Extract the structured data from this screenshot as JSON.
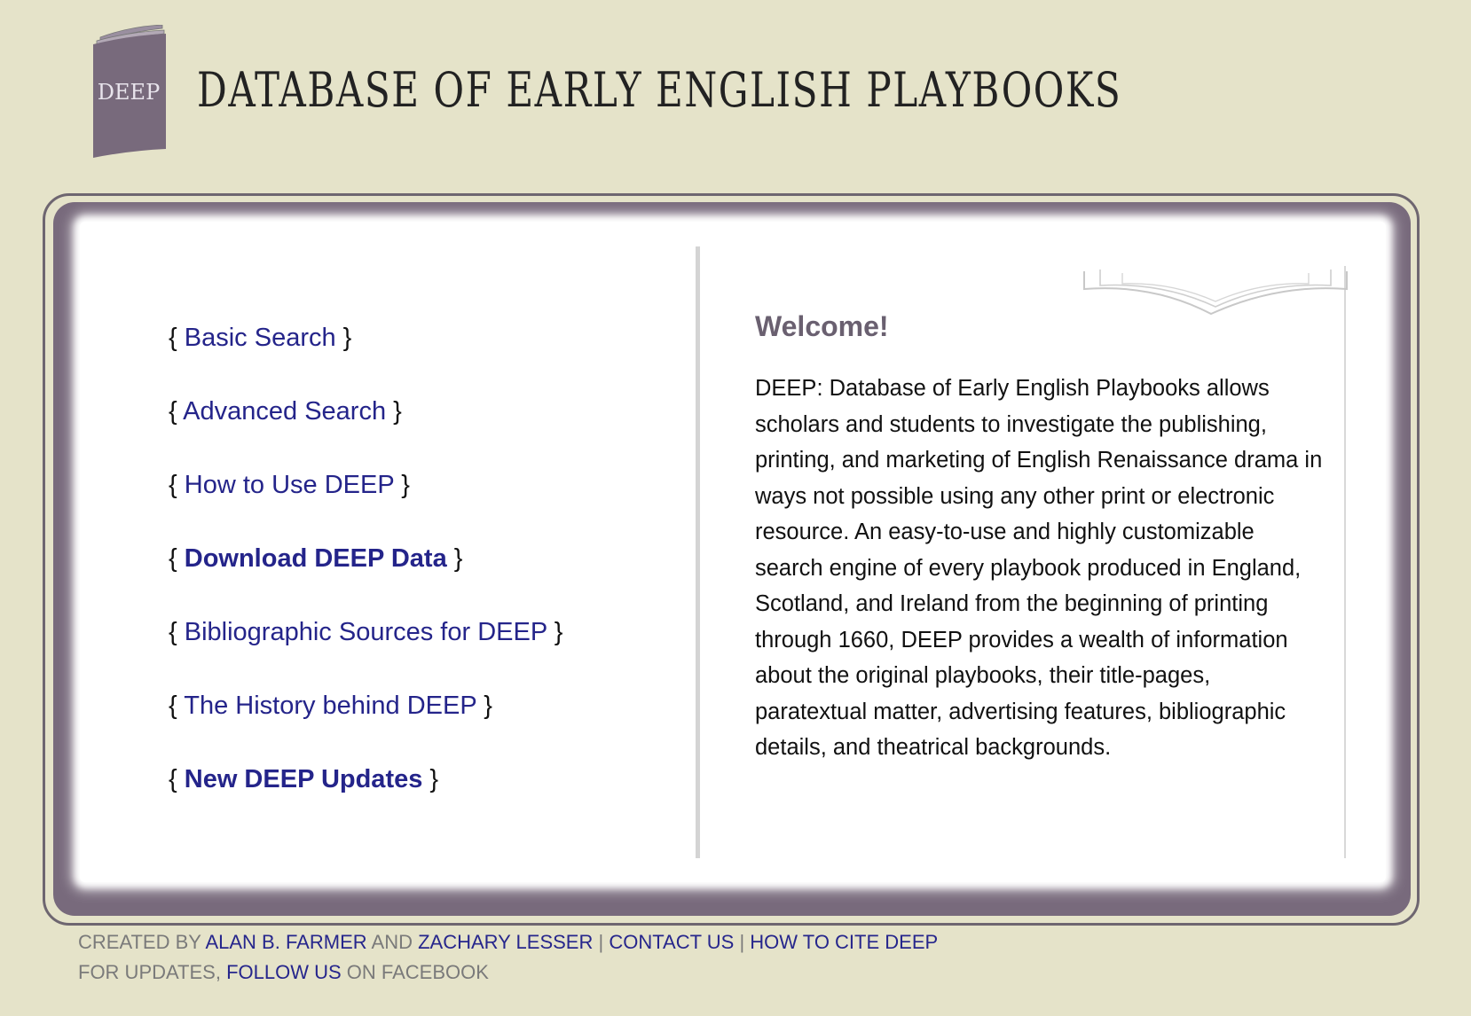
{
  "header": {
    "logo_text": "DEEP",
    "title": "DATABASE OF EARLY ENGLISH PLAYBOOKS"
  },
  "nav": {
    "items": [
      {
        "label": "Basic Search",
        "bold": false
      },
      {
        "label": "Advanced Search",
        "bold": false
      },
      {
        "label": "How to Use DEEP",
        "bold": false
      },
      {
        "label": "Download DEEP Data",
        "bold": true
      },
      {
        "label": "Bibliographic Sources for DEEP",
        "bold": false
      },
      {
        "label": "The History behind DEEP",
        "bold": false
      },
      {
        "label": "New DEEP Updates",
        "bold": true
      }
    ],
    "open_brace": "{",
    "close_brace": "}"
  },
  "welcome": {
    "title": "Welcome!",
    "body": "DEEP: Database of Early English Playbooks allows scholars and students to investigate the publishing, printing, and marketing of English Renaissance drama in ways not possible using any other print or electronic resource. An easy-to-use and highly customizable search engine of every playbook produced in England, Scotland, and Ireland from the beginning of printing through 1660, DEEP provides a wealth of information about the original playbooks, their title-pages, paratextual matter, advertising features, bibliographic details, and theatrical backgrounds."
  },
  "footer": {
    "created_by": "CREATED BY",
    "author1": "ALAN B. FARMER",
    "and": "AND",
    "author2": "ZACHARY LESSER",
    "sep": "|",
    "contact": "CONTACT US",
    "cite": "HOW TO CITE DEEP",
    "updates_prefix": "FOR UPDATES,",
    "follow": "FOLLOW US",
    "updates_suffix": "ON FACEBOOK"
  },
  "colors": {
    "background": "#e5e3c9",
    "frame": "#786a7c",
    "link": "#24248a"
  }
}
